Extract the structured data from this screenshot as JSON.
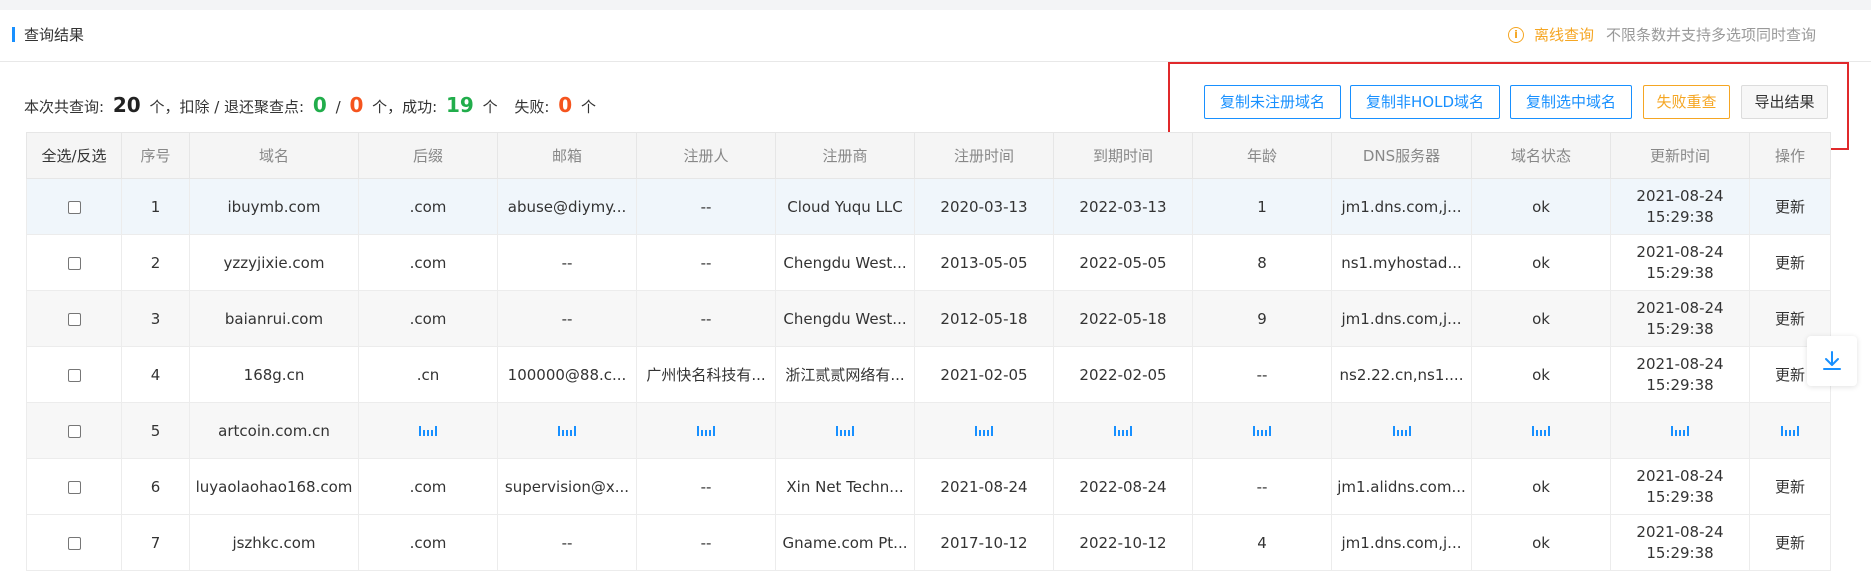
{
  "header": {
    "title": "查询结果",
    "offline_link": "离线查询",
    "offline_note": "不限条数并支持多选项同时查询"
  },
  "summary": {
    "label_total": "本次共查询:",
    "total": "20",
    "unit1": "个，扣除 / 退还聚查点:",
    "deducted": "0",
    "slash": "/",
    "refunded": "0",
    "unit2": "个，成功:",
    "success": "19",
    "unit3": "个",
    "label_fail": "失败:",
    "fail": "0",
    "unit4": "个"
  },
  "actions": {
    "copy_unregistered": "复制未注册域名",
    "copy_non_hold": "复制非HOLD域名",
    "copy_selected": "复制选中域名",
    "retry_failed": "失败重查",
    "export": "导出结果"
  },
  "table": {
    "columns": [
      "全选/反选",
      "序号",
      "域名",
      "后缀",
      "邮箱",
      "注册人",
      "注册商",
      "注册时间",
      "到期时间",
      "年龄",
      "DNS服务器",
      "域名状态",
      "更新时间",
      "操作"
    ],
    "rows": [
      {
        "idx": "1",
        "domain": "ibuymb.com",
        "suffix": ".com",
        "email": "abuse@diymy...",
        "registrant": "--",
        "registrar": "Cloud Yuqu LLC",
        "reg_date": "2020-03-13",
        "exp_date": "2022-03-13",
        "age": "1",
        "dns": "jm1.dns.com,j...",
        "status": "ok",
        "update_date": "2021-08-24",
        "update_time": "15:29:38",
        "op": "更新",
        "loading": false
      },
      {
        "idx": "2",
        "domain": "yzzyjixie.com",
        "suffix": ".com",
        "email": "--",
        "registrant": "--",
        "registrar": "Chengdu West...",
        "reg_date": "2013-05-05",
        "exp_date": "2022-05-05",
        "age": "8",
        "dns": "ns1.myhostad...",
        "status": "ok",
        "update_date": "2021-08-24",
        "update_time": "15:29:38",
        "op": "更新",
        "loading": false
      },
      {
        "idx": "3",
        "domain": "baianrui.com",
        "suffix": ".com",
        "email": "--",
        "registrant": "--",
        "registrar": "Chengdu West...",
        "reg_date": "2012-05-18",
        "exp_date": "2022-05-18",
        "age": "9",
        "dns": "jm1.dns.com,j...",
        "status": "ok",
        "update_date": "2021-08-24",
        "update_time": "15:29:38",
        "op": "更新",
        "loading": false
      },
      {
        "idx": "4",
        "domain": "168g.cn",
        "suffix": ".cn",
        "email": "100000@88.c...",
        "registrant": "广州快名科技有...",
        "registrar": "浙江贰贰网络有...",
        "reg_date": "2021-02-05",
        "exp_date": "2022-02-05",
        "age": "--",
        "dns": "ns2.22.cn,ns1....",
        "status": "ok",
        "update_date": "2021-08-24",
        "update_time": "15:29:38",
        "op": "更新",
        "loading": false
      },
      {
        "idx": "5",
        "domain": "artcoin.com.cn",
        "loading": true
      },
      {
        "idx": "6",
        "domain": "luyaolaohao168.com",
        "suffix": ".com",
        "email": "supervision@x...",
        "registrant": "--",
        "registrar": "Xin Net Techn...",
        "reg_date": "2021-08-24",
        "exp_date": "2022-08-24",
        "age": "--",
        "dns": "jm1.alidns.com...",
        "status": "ok",
        "update_date": "2021-08-24",
        "update_time": "15:29:38",
        "op": "更新",
        "loading": false
      },
      {
        "idx": "7",
        "domain": "jszhkc.com",
        "suffix": ".com",
        "email": "--",
        "registrant": "--",
        "registrar": "Gname.com Pt...",
        "reg_date": "2017-10-12",
        "exp_date": "2022-10-12",
        "age": "4",
        "dns": "jm1.dns.com,j...",
        "status": "ok",
        "update_date": "2021-08-24",
        "update_time": "15:29:38",
        "op": "更新",
        "loading": false
      }
    ]
  },
  "icons": {
    "info": "info-circle-icon",
    "download": "download-arrow-icon"
  },
  "colors": {
    "primary": "#1890ff",
    "warning": "#f5a623",
    "success": "#21ad4b",
    "danger": "#f5541e",
    "highlight_box": "#e0292b"
  }
}
